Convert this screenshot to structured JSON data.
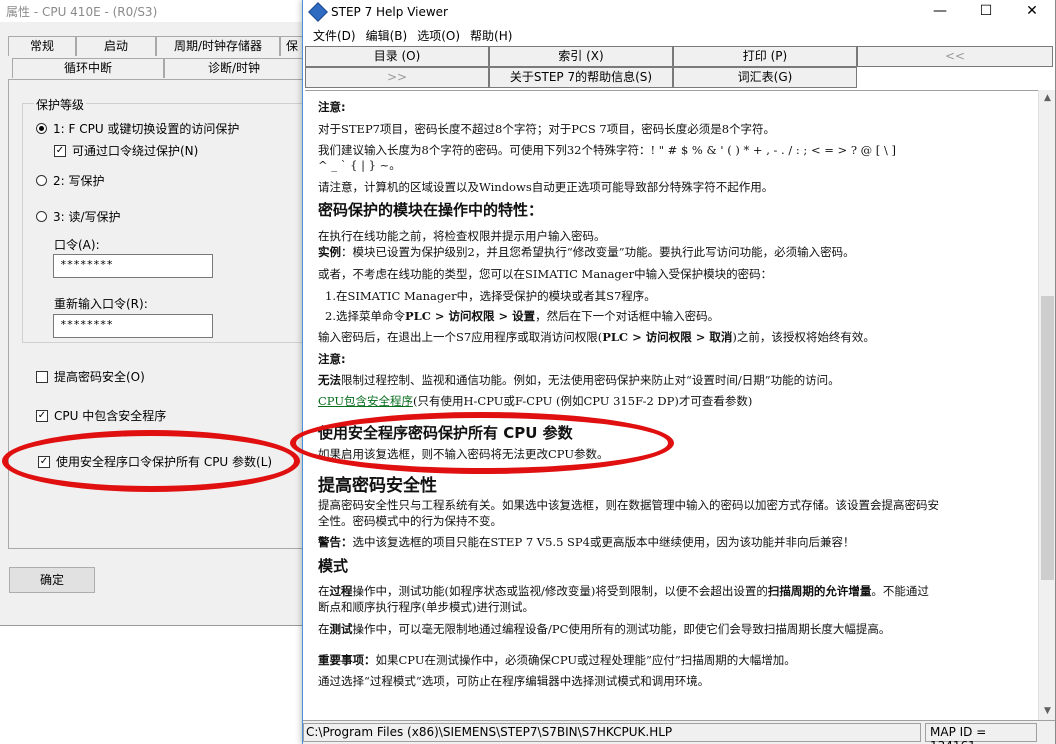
{
  "props_dialog": {
    "title": "属性 - CPU 410E - (R0/S3)",
    "tabs_row1": [
      "常规",
      "启动",
      "周期/时钟存储器",
      "保"
    ],
    "tabs_row2": [
      "循环中断",
      "诊断/时钟"
    ],
    "group_label": "保护等级",
    "level1_label": "1: F CPU 或键切换设置的访问保护",
    "level1_sub_check": "可通过口令绕过保护(N)",
    "level2_label": "2: 写保护",
    "level3_label": "3: 读/写保护",
    "password_label": "口令(A):",
    "password_value": "********",
    "repassword_label": "重新输入口令(R):",
    "repassword_value": "********",
    "enhance_label": "提高密码安全(O)",
    "cpu_contains_label": "CPU 中包含安全程序",
    "use_safety_label": "使用安全程序口令保护所有 CPU 参数(L)",
    "ok_label": "确定"
  },
  "help_window": {
    "title": "STEP 7 Help Viewer",
    "window_controls": [
      "—",
      "☐",
      "✕"
    ],
    "menu": [
      "文件(D)",
      "编辑(B)",
      "选项(O)",
      "帮助(H)"
    ],
    "nav_row1": [
      "目录 (O)",
      "索引 (X)",
      "打印 (P)",
      "<<"
    ],
    "nav_row2": [
      ">>",
      "关于STEP 7的帮助信息(S)",
      "词汇表(G)"
    ],
    "status_path": "C:\\Program Files (x86)\\SIEMENS\\STEP7\\S7BIN\\S7HKCPUK.HLP",
    "status_map": "MAP ID = 134161"
  },
  "help_content": {
    "note1_head": "注意:",
    "note1_l1": "对于STEP7项目，密码长度不超过8个字符；对于PCS 7项目，密码长度必须是8个字符。",
    "note1_l2": "我们建议输入长度为8个字符的密码。可使用下列32个特殊字符：! \" # $ % & ' ( ) * + , - . / : ; < = > ? @ [ \\ ]",
    "note1_l3": "^ _ ` { | } ~。",
    "note1_l4": "请注意，计算机的区域设置以及Windows自动更正选项可能导致部分特殊字符不起作用。",
    "sec1_head": "密码保护的模块在操作中的特性：",
    "sec1_l1": "在执行在线功能之前，将检查权限并提示用户输入密码。",
    "sec1_ex_bold": "实例",
    "sec1_ex_rest": "：模块已设置为保护级别2，并且您希望执行“修改变量”功能。要执行此写访问功能，必须输入密码。",
    "sec1_l3": "或者，不考虑在线功能的类型，您可以在SIMATIC Manager中输入受保护模块的密码：",
    "sec1_step1": "1.在SIMATIC Manager中，选择受保护的模块或者其S7程序。",
    "sec1_step2_a": "2.选择菜单命令",
    "sec1_step2_b": "PLC > 访问权限 > 设置",
    "sec1_step2_c": "，然后在下一个对话框中输入密码。",
    "sec1_l6_a": "输入密码后，在退出上一个S7应用程序或取消访问权限(",
    "sec1_l6_b": "PLC > 访问权限 > 取消",
    "sec1_l6_c": ")之前，该授权将始终有效。",
    "note2_head": "注意:",
    "note2_l1_bold": "无法",
    "note2_l1_rest": "限制过程控制、监视和通信功能。例如，无法使用密码保护来防止对“设置时间/日期”功能的访问。",
    "note2_link": "CPU包含安全程序",
    "note2_l2_rest": "(只有使用H-CPU或F-CPU (例如CPU 315F-2 DP)才可查看参数)",
    "sec2_head": "使用安全程序密码保护所有 CPU 参数",
    "sec2_l1": "如果启用该复选框，则不输入密码将无法更改CPU参数。",
    "sec3_head": "提高密码安全性",
    "sec3_l1": "提高密码安全性只与工程系统有关。如果选中该复选框，则在数据管理中输入的密码以加密方式存储。该设置会提高密码安",
    "sec3_l2": "全性。密码模式中的行为保持不变。",
    "sec3_warn_bold": "警告：",
    "sec3_warn_rest": "选中该复选框的项目只能在STEP 7 V5.5 SP4或更高版本中继续使用，因为该功能并非向后兼容！",
    "sec4_head": "模式",
    "sec4_l1_a": "在",
    "sec4_l1_b": "过程",
    "sec4_l1_c": "操作中，测试功能(如程序状态或监视/修改变量)将受到限制，以便不会超出设置的",
    "sec4_l1_d": "扫描周期的允许增量",
    "sec4_l1_e": "。不能通过",
    "sec4_l2": "断点和顺序执行程序(单步模式)进行测试。",
    "sec4_l3_a": "在",
    "sec4_l3_b": "测试",
    "sec4_l3_c": "操作中，可以毫无限制地通过编程设备/PC使用所有的测试功能，即使它们会导致扫描周期长度大幅提高。",
    "imp_bold": "重要事项：",
    "imp_rest": "如果CPU在测试操作中，必须确保CPU或过程处理能”应付”扫描周期的大幅增加。",
    "imp_l2": "通过选择“过程模式”选项，可防止在程序编辑器中选择测试模式和调用环境。"
  },
  "annotation_color": "#e01010"
}
